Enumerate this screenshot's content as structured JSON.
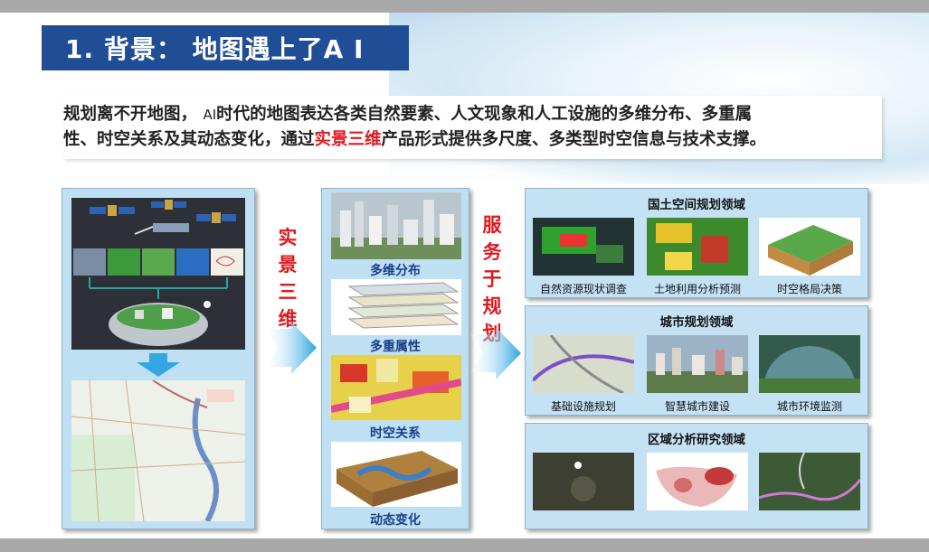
{
  "header": {
    "title": "1. 背景：  地图遇上了A I"
  },
  "intro": {
    "part1": "规划离不开地图，",
    "ai_text": "AI",
    "part2": "时代的地图表达各类自然要素、人文现象和人工设施的多维分布、多重属",
    "part3": "性、时空关系及其动态变化，通过",
    "highlight": "实景三维",
    "part4": "产品形式提供多尺度、多类型时空信息与技术支撑。"
  },
  "left_arrow_text": [
    "实",
    "景",
    "三",
    "维"
  ],
  "right_arrow_text": [
    "服",
    "务",
    "于",
    "规",
    "划"
  ],
  "middle": {
    "items": [
      {
        "label": "多维分布"
      },
      {
        "label": "多重属性"
      },
      {
        "label": "时空关系"
      },
      {
        "label": "动态变化"
      }
    ]
  },
  "right": {
    "sections": [
      {
        "title": "国土空间规划领域",
        "thumbs": [
          "自然资源现状调查",
          "土地利用分析预测",
          "时空格局决策"
        ]
      },
      {
        "title": "城市规划领域",
        "thumbs": [
          "基础设施规划",
          "智慧城市建设",
          "城市环境监测"
        ]
      },
      {
        "title": "区域分析研究领域",
        "thumbs": [
          "",
          "",
          ""
        ]
      }
    ]
  },
  "colors": {
    "title_bg": "#1f4e96",
    "highlight": "#e0191e",
    "panel_bg": "#bfe0f3",
    "label_blue": "#1a3e8a"
  }
}
